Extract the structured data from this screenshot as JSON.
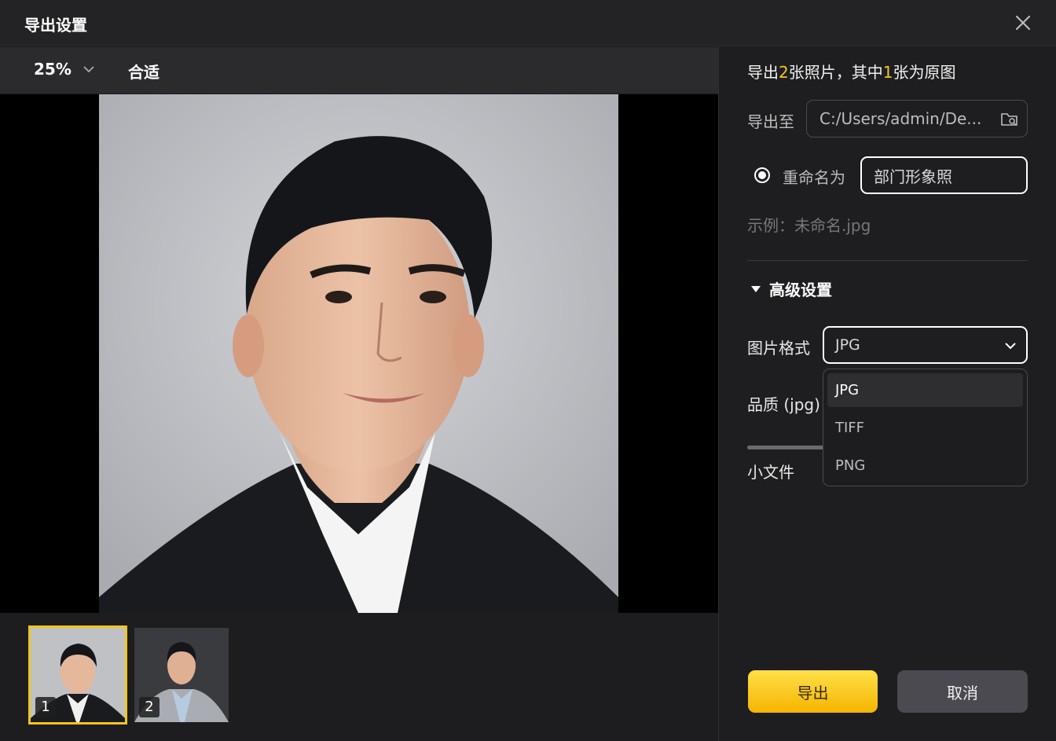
{
  "window": {
    "title": "导出设置"
  },
  "icons": {
    "close": "close-icon",
    "chevron": "chevron-down-icon",
    "folder": "folder-search-icon",
    "triangle": "caret-down-icon"
  },
  "toolbar": {
    "zoom": "25%",
    "fit": "合适"
  },
  "thumbnails": [
    {
      "number": "1",
      "selected": true
    },
    {
      "number": "2",
      "selected": false
    }
  ],
  "panel": {
    "summary": {
      "p1": "导出",
      "count": "2",
      "p2": "张照片，其中",
      "original": "1",
      "p3": "张为原图"
    },
    "export_to_label": "导出至",
    "export_path": "C:/Users/admin/De...",
    "rename_label": "重命名为",
    "rename_value": "部门形象照",
    "example": "示例：未命名.jpg",
    "advanced_label": "高级设置",
    "format_label": "图片格式",
    "format_value": "JPG",
    "quality_label": "品质 (jpg)",
    "small_file_label": "小文件",
    "format_options": [
      "JPG",
      "TIFF",
      "PNG"
    ],
    "export_button": "导出",
    "cancel_button": "取消"
  },
  "colors": {
    "accent": "#f5c518",
    "background": "#1e1e20"
  }
}
